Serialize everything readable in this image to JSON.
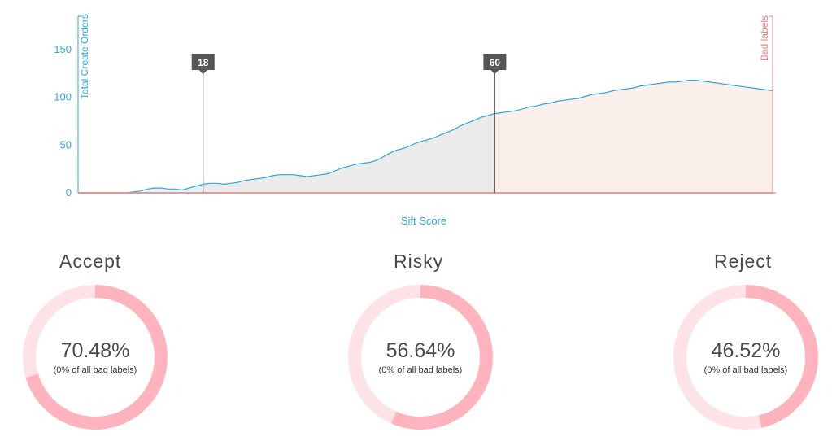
{
  "colors": {
    "accent_blue": "#2fa6dd",
    "accent_red": "#f08080",
    "donut_light": "#fde3e6",
    "donut_dark": "#ffb3bd",
    "region_accept": "#e4f3fa",
    "region_risky": "#ebebeb",
    "region_reject": "#fbefec"
  },
  "chart_data": {
    "type": "area",
    "xlabel": "Sift Score",
    "ylabel_left": "Total Create Orders",
    "ylabel_right": "Bad labels",
    "ylim": [
      0,
      185
    ],
    "xlim": [
      0,
      100
    ],
    "yticks": [
      0,
      50,
      100,
      150
    ],
    "grid": false,
    "markers": [
      {
        "label": "18",
        "x": 18
      },
      {
        "label": "60",
        "x": 60
      }
    ],
    "series": [
      {
        "x": [
          0,
          1,
          2,
          3,
          4,
          5,
          6,
          7,
          8,
          9,
          10,
          11,
          12,
          13,
          14,
          15,
          16,
          17,
          18,
          19,
          20,
          21,
          22,
          23,
          24,
          25,
          26,
          27,
          28,
          29,
          30,
          31,
          32,
          33,
          34,
          35,
          36,
          37,
          38,
          39,
          40,
          41,
          42,
          43,
          44,
          45,
          46,
          47,
          48,
          49,
          50,
          51,
          52,
          53,
          54,
          55,
          56,
          57,
          58,
          59,
          60,
          61,
          62,
          63,
          64,
          65,
          66,
          67,
          68,
          69,
          70,
          71,
          72,
          73,
          74,
          75,
          76,
          77,
          78,
          79,
          80,
          81,
          82,
          83,
          84,
          85,
          86,
          87,
          88,
          89,
          90,
          91,
          92,
          93,
          94,
          95,
          96,
          97,
          98,
          99,
          100
        ],
        "values": [
          0,
          0,
          0,
          0,
          0,
          0,
          0,
          0,
          1,
          2,
          4,
          5,
          5,
          4,
          4,
          3,
          5,
          7,
          9,
          10,
          10,
          9,
          10,
          11,
          13,
          14,
          15,
          16,
          18,
          19,
          19,
          19,
          18,
          17,
          18,
          19,
          20,
          23,
          26,
          28,
          30,
          31,
          32,
          34,
          38,
          42,
          45,
          47,
          50,
          53,
          55,
          57,
          60,
          63,
          66,
          70,
          73,
          76,
          79,
          81,
          83,
          84,
          85,
          86,
          88,
          90,
          91,
          93,
          94,
          96,
          97,
          98,
          99,
          101,
          103,
          104,
          105,
          107,
          108,
          109,
          110,
          112,
          113,
          114,
          115,
          116,
          116,
          117,
          118,
          118,
          117,
          116,
          115,
          114,
          113,
          112,
          111,
          110,
          109,
          108,
          107
        ]
      }
    ],
    "bad_labels_values": [
      0,
      0,
      0,
      0,
      0,
      0,
      0,
      0,
      0,
      0,
      0,
      0,
      0,
      0,
      0,
      0,
      0,
      0,
      0,
      0,
      0,
      0,
      0,
      0,
      0,
      0,
      0,
      0,
      0,
      0,
      0,
      0,
      0,
      0,
      0,
      0,
      0,
      0,
      0,
      0,
      0,
      0,
      0,
      0,
      0,
      0,
      0,
      0,
      0,
      0,
      0,
      0,
      0,
      0,
      0,
      0,
      0,
      0,
      0,
      0,
      0,
      0,
      0,
      0,
      0,
      0,
      0,
      0,
      0,
      0,
      0,
      0,
      0,
      0,
      0,
      0,
      0,
      0,
      0,
      0,
      0,
      0,
      0,
      0,
      0,
      0,
      0,
      0,
      0,
      0,
      0,
      0,
      0,
      0,
      0,
      0,
      0,
      0,
      0,
      0,
      0
    ]
  },
  "donuts": [
    {
      "title": "Accept",
      "percent": "70.48%",
      "fraction": 0.7048,
      "subtitle": "(0% of all bad labels)"
    },
    {
      "title": "Risky",
      "percent": "56.64%",
      "fraction": 0.5664,
      "subtitle": "(0% of all bad labels)"
    },
    {
      "title": "Reject",
      "percent": "46.52%",
      "fraction": 0.4652,
      "subtitle": "(0% of all bad labels)"
    }
  ]
}
